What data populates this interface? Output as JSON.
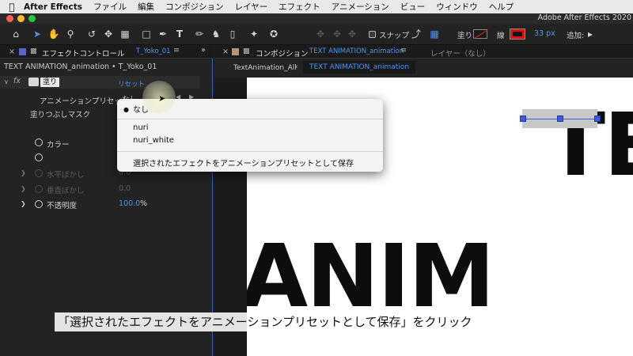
{
  "menubar": {
    "app_name": "After Effects",
    "items": [
      "ファイル",
      "編集",
      "コンポジション",
      "レイヤー",
      "エフェクト",
      "アニメーション",
      "ビュー",
      "ウィンドウ",
      "ヘルプ"
    ]
  },
  "window": {
    "title": "Adobe After Effects 2020"
  },
  "toolbar": {
    "snap_label": "スナップ",
    "fill_label": "塗り",
    "stroke_label": "線",
    "stroke_width": "33 px",
    "add_label": "追加:"
  },
  "effect_panel": {
    "tab_title": "エフェクトコントロール",
    "tab_layer": "T_Yoko_01",
    "path": "TEXT ANIMATION_animation • T_Yoko_01",
    "effect_name": "塗り",
    "reset_label": "リセット",
    "preset_label": "アニメーションプリセット：",
    "preset_value": "なし",
    "mask_label": "塗りつぶしマスク",
    "color_label": "カラー",
    "h_blur_label": "水平ぼかし",
    "h_blur_value": "0.0",
    "v_blur_label": "垂直ぼかし",
    "v_blur_value": "0.0",
    "opacity_label": "不透明度",
    "opacity_value": "100.0",
    "opacity_unit": "%"
  },
  "comp_panel": {
    "tab_title": "コンポジション",
    "tab_name": "TEXT ANIMATION_animation",
    "layer_tab": "レイヤー（なし）",
    "breadcrumb_1": "TextAnimation_All",
    "breadcrumb_2": "TEXT ANIMATION_animation",
    "canvas_line1": "TE",
    "canvas_line2": "ANIM"
  },
  "dropdown": {
    "selected": "なし",
    "items": [
      "nuri",
      "nuri_white"
    ],
    "save_item": "選択されたエフェクトをアニメーションプリセットとして保存"
  },
  "caption": "「選択されたエフェクトをアニメーションプリセットとして保存」をクリック",
  "colors": {
    "accent_blue": "#4f92ef",
    "label_purple": "#5866c7",
    "stroke_red": "#dd1111"
  }
}
